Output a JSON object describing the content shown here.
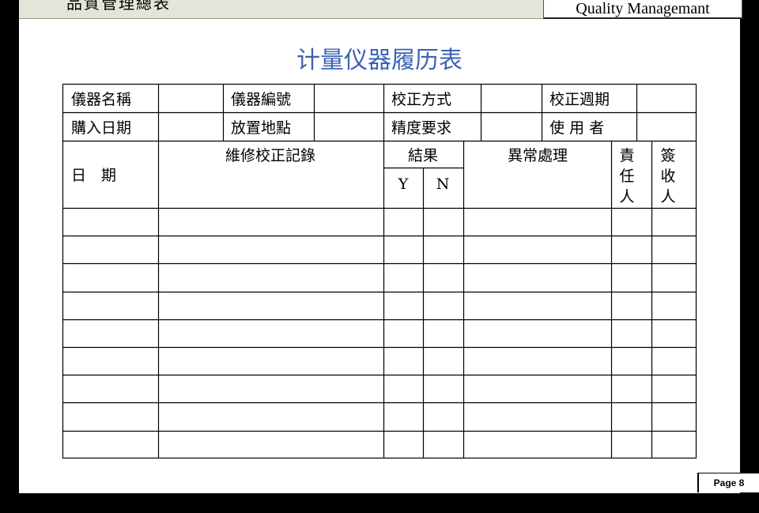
{
  "header": {
    "top_band_text": "品質管理總表",
    "right_label": "Quality Managemant"
  },
  "form": {
    "title": "计量仪器履历表",
    "row1": [
      "儀器名稱",
      "儀器編號",
      "校正方式",
      "校正週期"
    ],
    "row2": [
      "購入日期",
      "放置地點",
      "精度要求",
      "使 用 者"
    ],
    "col_date": "日　期",
    "col_record": "維修校正記錄",
    "col_result": "結果",
    "col_y": "Y",
    "col_n": "N",
    "col_abnormal": "異常處理",
    "col_responsible": [
      "責",
      "任",
      "人"
    ],
    "col_signed": [
      "簽",
      "收",
      "人"
    ]
  },
  "footer": {
    "page_label": "Page 8"
  }
}
